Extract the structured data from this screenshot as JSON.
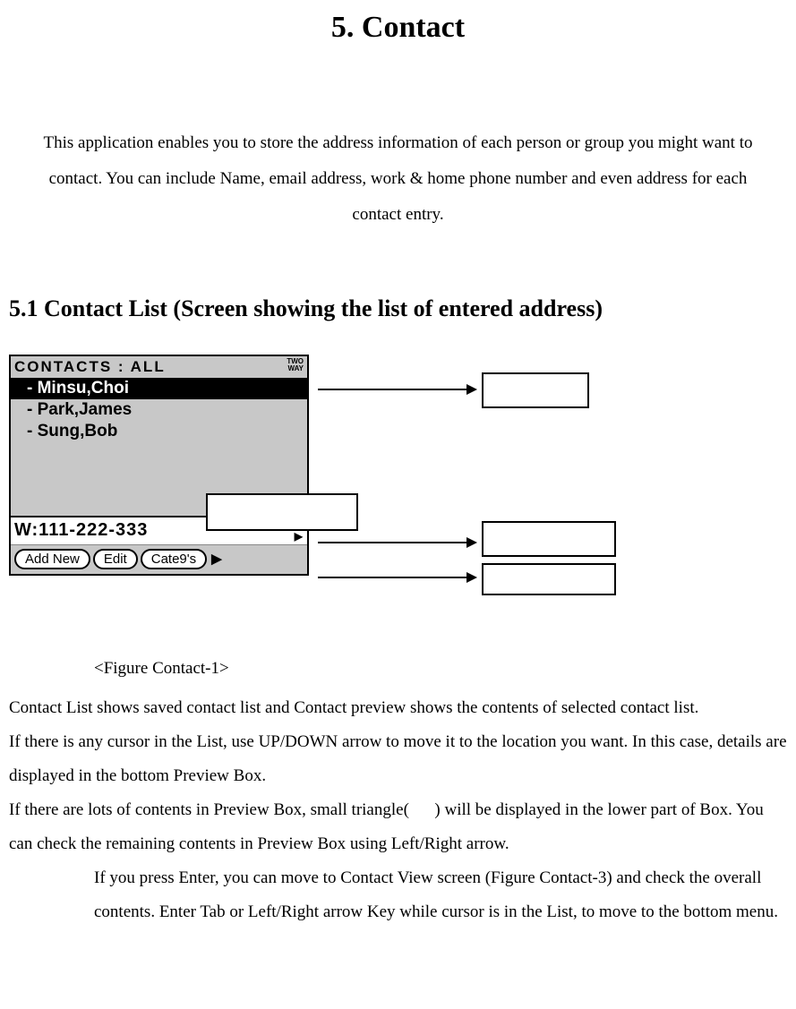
{
  "title": "5. Contact",
  "intro": "This application enables you to store the address information of each person or group you might want to contact. You can include Name, email address, work & home phone number and even address for each contact entry.",
  "section_heading": "5.1 Contact List (Screen showing the list of entered address)",
  "device": {
    "header_title": "CONTACTS : ALL",
    "header_indicator_line1": "TWO",
    "header_indicator_line2": "WAY",
    "contacts": [
      {
        "label": "- Minsu,Choi",
        "selected": true
      },
      {
        "label": "- Park,James",
        "selected": false
      },
      {
        "label": "- Sung,Bob",
        "selected": false
      }
    ],
    "preview_text": "W:111-222-333",
    "menu": {
      "add_new": "Add New",
      "edit": "Edit",
      "categories": "Cate9's"
    }
  },
  "figure_caption": "<Figure Contact-1>",
  "body": {
    "p1": "Contact List shows saved contact list and Contact preview shows the contents of selected contact list.",
    "p2": "If there is any cursor in the List, use UP/DOWN arrow to move it to the location you want. In this case, details are displayed in the bottom Preview Box.",
    "p3_a": "If there are lots of contents in Preview Box, small triangle( ",
    "p3_b": " ) will be displayed in the lower part of Box. You can check the remaining contents in Preview Box using Left/Right arrow.",
    "p4": "If you press Enter, you can move to Contact View screen (Figure Contact-3) and check the overall contents. Enter Tab or Left/Right arrow Key while cursor is in the List, to move to the bottom menu."
  }
}
